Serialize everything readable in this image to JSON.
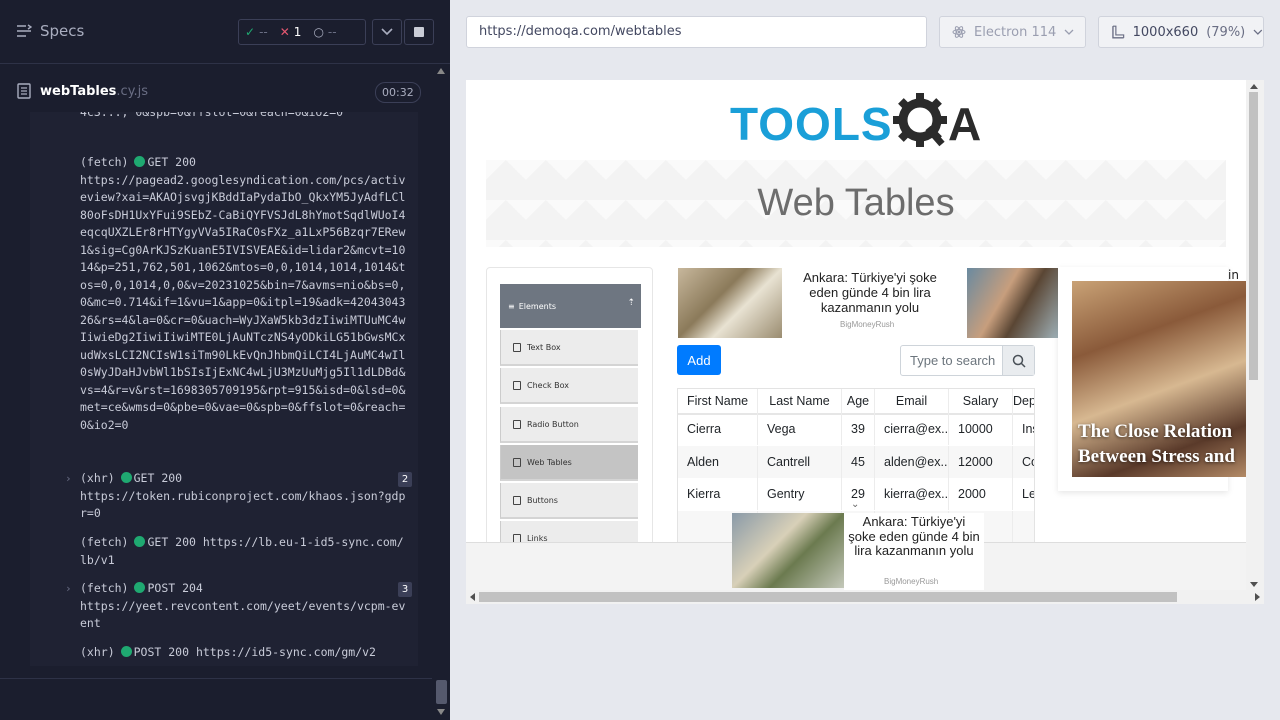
{
  "runner": {
    "specs_label": "Specs",
    "stats": {
      "passed": "--",
      "failed": "1",
      "pending": "--"
    },
    "spec_file": {
      "name": "webTables",
      "ext": ".cy.js",
      "duration": "00:32"
    }
  },
  "log": {
    "top_fragment": "4c3..., 0&spb=0&ffslot=0&reach=0&io2=0",
    "entries": [
      {
        "kind": "(fetch)",
        "method": "GET 200",
        "url": "https://pagead2.googlesyndication.com/pcs/activeview?xai=AKAOjsvgjKBddIaPydaIbO_QkxYM5JyAdfLCl80oFsDH1UxYFui9SEbZ-CaBiQYFVSJdL8hYmotSqdlWUoI4eqcqUXZLEr8rHTYgyVVa5IRaC0sFXz_a1LxP56Bzqr7ERew1&sig=Cg0ArKJSzKuanE5IVISVEAE&id=lidar2&mcvt=1014&p=251,762,501,1062&mtos=0,0,1014,1014,1014&tos=0,0,1014,0,0&v=20231025&bin=7&avms=nio&bs=0,0&mc=0.714&if=1&vu=1&app=0&itpl=19&adk=4204304326&rs=4&la=0&cr=0&uach=WyJXaW5kb3dzIiwiMTUuMC4wIiwieDg2IiwiIiwiMTE0LjAuNTczNS4yODkiLG51bGwsMCxudWxsLCI2NCIsW1siTm90LkEvQnJhbmQiLCI4LjAuMC4wIl0sWyJDaHJvbWl1bSIsIjExNC4wLjU3MzUuMjg5Il1dLDBd&vs=4&r=v&rst=1698305709195&rpt=915&isd=0&lsd=0&met=ce&wmsd=0&pbe=0&vae=0&spb=0&ffslot=0&reach=0&io2=0",
        "count": ""
      },
      {
        "kind": "(xhr)",
        "method": "GET 200",
        "url": "https://token.rubiconproject.com/khaos.json?gdpr=0",
        "count": "2"
      },
      {
        "kind": "(fetch)",
        "method": "GET 200",
        "url": "https://lb.eu-1-id5-sync.com/lb/v1",
        "count": ""
      },
      {
        "kind": "(fetch)",
        "method": "POST 204",
        "url": "https://yeet.revcontent.com/yeet/events/vcpm-event",
        "count": "3"
      },
      {
        "kind": "(xhr)",
        "method": "POST 200",
        "url": "https://id5-sync.com/gm/v2",
        "count": ""
      }
    ]
  },
  "toolbar": {
    "url": "https://demoqa.com/webtables",
    "browser": "Electron 114",
    "viewport": "1000x660",
    "zoom": "(79%)"
  },
  "page": {
    "logo_text": "TOOLSQA",
    "banner_title": "Web Tables",
    "sidebar": {
      "group": "Elements",
      "items": [
        "Text Box",
        "Check Box",
        "Radio Button",
        "Web Tables",
        "Buttons",
        "Links"
      ],
      "active": "Web Tables"
    },
    "ad_top": {
      "text": "Ankara: Türkiye'yi şoke eden günde 4 bin lira kazanmanın yolu",
      "source": "BigMoneyRush",
      "trailing": "in"
    },
    "add_button": "Add",
    "search_placeholder": "Type to search",
    "table": {
      "headers": [
        "First Name",
        "Last Name",
        "Age",
        "Email",
        "Salary",
        "Dep"
      ],
      "rows": [
        [
          "Cierra",
          "Vega",
          "39",
          "cierra@ex...",
          "10000",
          "Insu"
        ],
        [
          "Alden",
          "Cantrell",
          "45",
          "alden@ex...",
          "12000",
          "Com"
        ],
        [
          "Kierra",
          "Gentry",
          "29",
          "kierra@ex...",
          "2000",
          "Leg"
        ]
      ]
    },
    "ad_right": {
      "headline_1": "The Close Relation",
      "headline_2": "Between Stress and"
    },
    "ad_sticky": {
      "text": "Ankara: Türkiye'yi şoke eden günde 4 bin lira kazanmanın yolu",
      "source": "BigMoneyRush"
    }
  },
  "colors": {
    "runner_bg": "#1b1e2e",
    "pass": "#1fa971",
    "fail": "#e45770",
    "primary": "#007bff",
    "logo_blue": "#1a9fd8"
  }
}
